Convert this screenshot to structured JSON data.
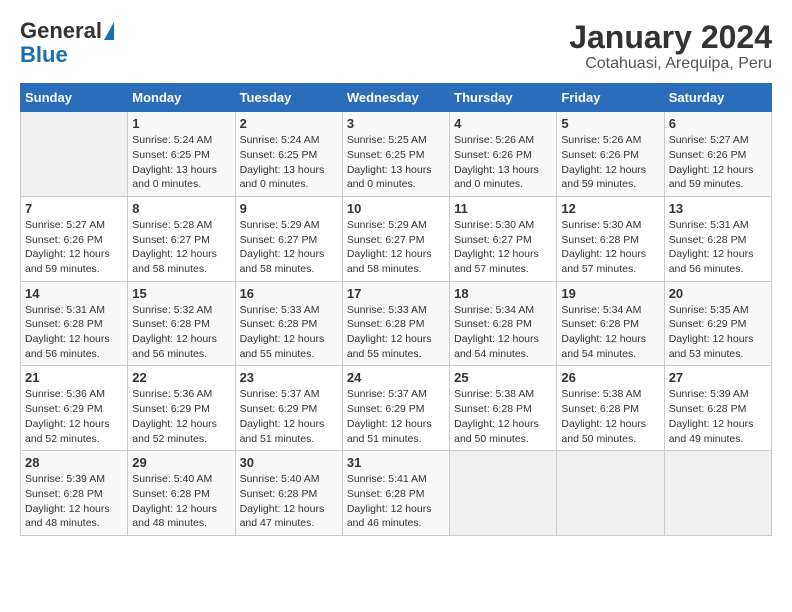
{
  "header": {
    "logo_general": "General",
    "logo_blue": "Blue",
    "title": "January 2024",
    "subtitle": "Cotahuasi, Arequipa, Peru"
  },
  "columns": [
    "Sunday",
    "Monday",
    "Tuesday",
    "Wednesday",
    "Thursday",
    "Friday",
    "Saturday"
  ],
  "weeks": [
    [
      {
        "day": "",
        "info": ""
      },
      {
        "day": "1",
        "info": "Sunrise: 5:24 AM\nSunset: 6:25 PM\nDaylight: 13 hours\nand 0 minutes."
      },
      {
        "day": "2",
        "info": "Sunrise: 5:24 AM\nSunset: 6:25 PM\nDaylight: 13 hours\nand 0 minutes."
      },
      {
        "day": "3",
        "info": "Sunrise: 5:25 AM\nSunset: 6:25 PM\nDaylight: 13 hours\nand 0 minutes."
      },
      {
        "day": "4",
        "info": "Sunrise: 5:26 AM\nSunset: 6:26 PM\nDaylight: 13 hours\nand 0 minutes."
      },
      {
        "day": "5",
        "info": "Sunrise: 5:26 AM\nSunset: 6:26 PM\nDaylight: 12 hours\nand 59 minutes."
      },
      {
        "day": "6",
        "info": "Sunrise: 5:27 AM\nSunset: 6:26 PM\nDaylight: 12 hours\nand 59 minutes."
      }
    ],
    [
      {
        "day": "7",
        "info": "Sunrise: 5:27 AM\nSunset: 6:26 PM\nDaylight: 12 hours\nand 59 minutes."
      },
      {
        "day": "8",
        "info": "Sunrise: 5:28 AM\nSunset: 6:27 PM\nDaylight: 12 hours\nand 58 minutes."
      },
      {
        "day": "9",
        "info": "Sunrise: 5:29 AM\nSunset: 6:27 PM\nDaylight: 12 hours\nand 58 minutes."
      },
      {
        "day": "10",
        "info": "Sunrise: 5:29 AM\nSunset: 6:27 PM\nDaylight: 12 hours\nand 58 minutes."
      },
      {
        "day": "11",
        "info": "Sunrise: 5:30 AM\nSunset: 6:27 PM\nDaylight: 12 hours\nand 57 minutes."
      },
      {
        "day": "12",
        "info": "Sunrise: 5:30 AM\nSunset: 6:28 PM\nDaylight: 12 hours\nand 57 minutes."
      },
      {
        "day": "13",
        "info": "Sunrise: 5:31 AM\nSunset: 6:28 PM\nDaylight: 12 hours\nand 56 minutes."
      }
    ],
    [
      {
        "day": "14",
        "info": "Sunrise: 5:31 AM\nSunset: 6:28 PM\nDaylight: 12 hours\nand 56 minutes."
      },
      {
        "day": "15",
        "info": "Sunrise: 5:32 AM\nSunset: 6:28 PM\nDaylight: 12 hours\nand 56 minutes."
      },
      {
        "day": "16",
        "info": "Sunrise: 5:33 AM\nSunset: 6:28 PM\nDaylight: 12 hours\nand 55 minutes."
      },
      {
        "day": "17",
        "info": "Sunrise: 5:33 AM\nSunset: 6:28 PM\nDaylight: 12 hours\nand 55 minutes."
      },
      {
        "day": "18",
        "info": "Sunrise: 5:34 AM\nSunset: 6:28 PM\nDaylight: 12 hours\nand 54 minutes."
      },
      {
        "day": "19",
        "info": "Sunrise: 5:34 AM\nSunset: 6:28 PM\nDaylight: 12 hours\nand 54 minutes."
      },
      {
        "day": "20",
        "info": "Sunrise: 5:35 AM\nSunset: 6:29 PM\nDaylight: 12 hours\nand 53 minutes."
      }
    ],
    [
      {
        "day": "21",
        "info": "Sunrise: 5:36 AM\nSunset: 6:29 PM\nDaylight: 12 hours\nand 52 minutes."
      },
      {
        "day": "22",
        "info": "Sunrise: 5:36 AM\nSunset: 6:29 PM\nDaylight: 12 hours\nand 52 minutes."
      },
      {
        "day": "23",
        "info": "Sunrise: 5:37 AM\nSunset: 6:29 PM\nDaylight: 12 hours\nand 51 minutes."
      },
      {
        "day": "24",
        "info": "Sunrise: 5:37 AM\nSunset: 6:29 PM\nDaylight: 12 hours\nand 51 minutes."
      },
      {
        "day": "25",
        "info": "Sunrise: 5:38 AM\nSunset: 6:28 PM\nDaylight: 12 hours\nand 50 minutes."
      },
      {
        "day": "26",
        "info": "Sunrise: 5:38 AM\nSunset: 6:28 PM\nDaylight: 12 hours\nand 50 minutes."
      },
      {
        "day": "27",
        "info": "Sunrise: 5:39 AM\nSunset: 6:28 PM\nDaylight: 12 hours\nand 49 minutes."
      }
    ],
    [
      {
        "day": "28",
        "info": "Sunrise: 5:39 AM\nSunset: 6:28 PM\nDaylight: 12 hours\nand 48 minutes."
      },
      {
        "day": "29",
        "info": "Sunrise: 5:40 AM\nSunset: 6:28 PM\nDaylight: 12 hours\nand 48 minutes."
      },
      {
        "day": "30",
        "info": "Sunrise: 5:40 AM\nSunset: 6:28 PM\nDaylight: 12 hours\nand 47 minutes."
      },
      {
        "day": "31",
        "info": "Sunrise: 5:41 AM\nSunset: 6:28 PM\nDaylight: 12 hours\nand 46 minutes."
      },
      {
        "day": "",
        "info": ""
      },
      {
        "day": "",
        "info": ""
      },
      {
        "day": "",
        "info": ""
      }
    ]
  ]
}
